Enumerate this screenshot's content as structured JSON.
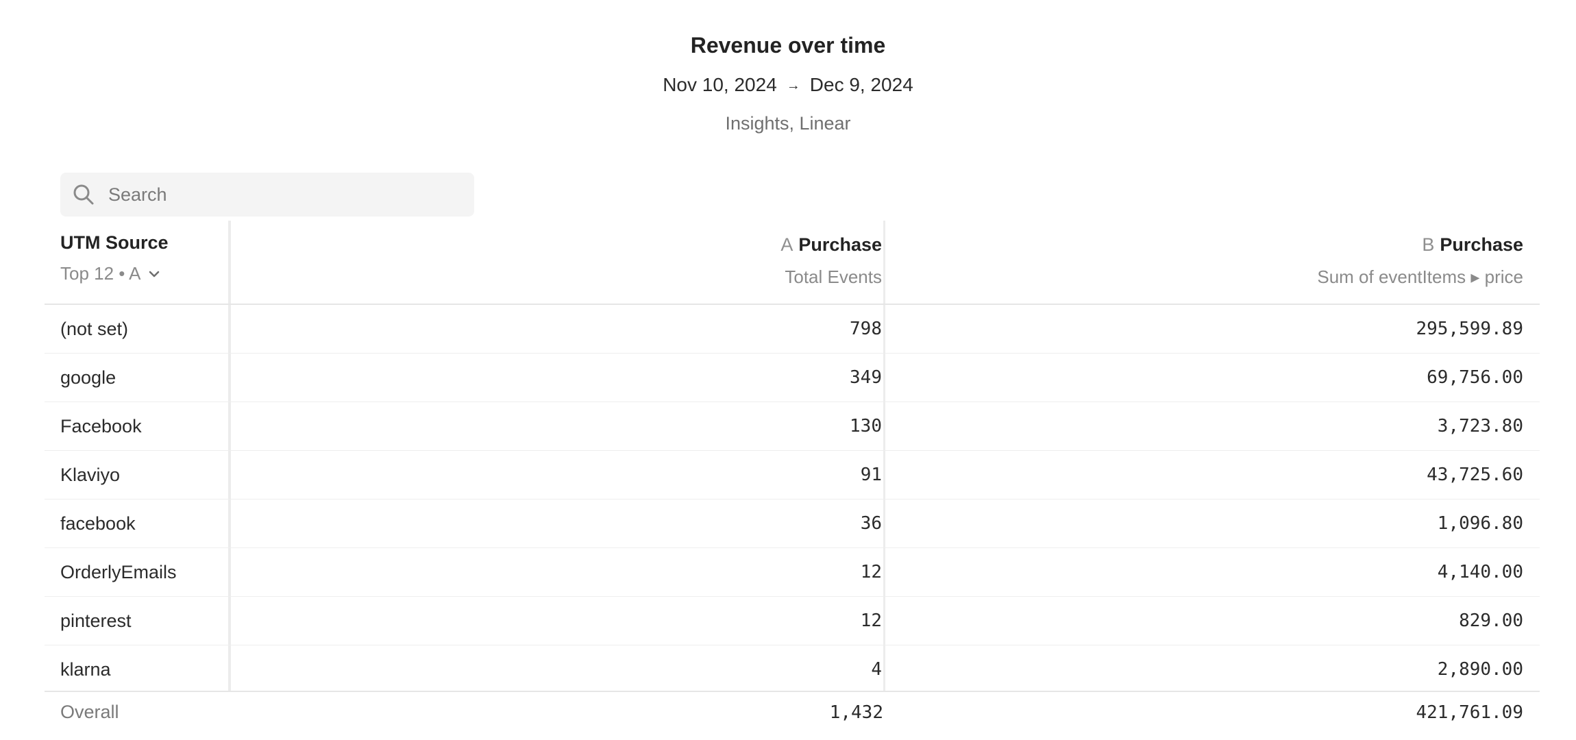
{
  "header": {
    "title": "Revenue over time",
    "date_start": "Nov 10, 2024",
    "date_arrow": "→",
    "date_end": "Dec 9, 2024",
    "subtitle": "Insights, Linear"
  },
  "search": {
    "placeholder": "Search",
    "icon": "search-icon"
  },
  "table": {
    "dimension": {
      "title": "UTM Source",
      "subtitle": "Top 12 • A",
      "icon": "chevron-down-icon"
    },
    "metrics": [
      {
        "letter": "A",
        "label": "Purchase",
        "sub": "Total Events"
      },
      {
        "letter": "B",
        "label": "Purchase",
        "sub": "Sum of eventItems ▸ price"
      }
    ],
    "rows": [
      {
        "name": "(not set)",
        "a": "798",
        "b": "295,599.89"
      },
      {
        "name": "google",
        "a": "349",
        "b": "69,756.00"
      },
      {
        "name": "Facebook",
        "a": "130",
        "b": "3,723.80"
      },
      {
        "name": "Klaviyo",
        "a": "91",
        "b": "43,725.60"
      },
      {
        "name": "facebook",
        "a": "36",
        "b": "1,096.80"
      },
      {
        "name": "OrderlyEmails",
        "a": "12",
        "b": "4,140.00"
      },
      {
        "name": "pinterest",
        "a": "12",
        "b": "829.00"
      },
      {
        "name": "klarna",
        "a": "4",
        "b": "2,890.00"
      }
    ],
    "overall": {
      "name": "Overall",
      "a": "1,432",
      "b": "421,761.09"
    }
  },
  "colors": {
    "text": "#2b2b2b",
    "muted": "#8a8a8a",
    "search_bg": "#f4f4f4",
    "divider": "#ececec"
  }
}
